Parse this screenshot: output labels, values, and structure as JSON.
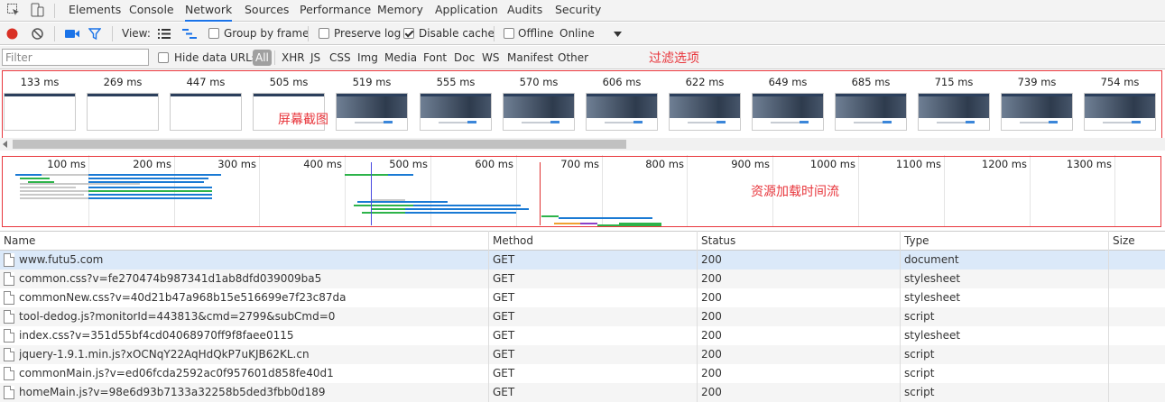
{
  "tabs": [
    "Elements",
    "Console",
    "Network",
    "Sources",
    "Performance",
    "Memory",
    "Application",
    "Audits",
    "Security"
  ],
  "toolbar": {
    "view_label": "View:",
    "group_by_frame": "Group by frame",
    "preserve_log": "Preserve log",
    "disable_cache": "Disable cache",
    "disable_cache_checked": true,
    "offline": "Offline",
    "throttle": "Online"
  },
  "filter": {
    "placeholder": "Filter",
    "hide_data_urls": "Hide data URLs",
    "types": [
      "All",
      "XHR",
      "JS",
      "CSS",
      "Img",
      "Media",
      "Font",
      "Doc",
      "WS",
      "Manifest",
      "Other"
    ]
  },
  "annotations": {
    "filter_options": "过滤选项",
    "screenshots": "屏幕截图",
    "waterfall": "资源加载时间流"
  },
  "screenshots": [
    {
      "time": "133 ms",
      "kind": "blank"
    },
    {
      "time": "269 ms",
      "kind": "blank"
    },
    {
      "time": "447 ms",
      "kind": "blank"
    },
    {
      "time": "505 ms",
      "kind": "blank"
    },
    {
      "time": "519 ms",
      "kind": "hero"
    },
    {
      "time": "555 ms",
      "kind": "hero"
    },
    {
      "time": "570 ms",
      "kind": "hero"
    },
    {
      "time": "606 ms",
      "kind": "hero"
    },
    {
      "time": "622 ms",
      "kind": "hero"
    },
    {
      "time": "649 ms",
      "kind": "hero"
    },
    {
      "time": "685 ms",
      "kind": "hero"
    },
    {
      "time": "715 ms",
      "kind": "hero"
    },
    {
      "time": "739 ms",
      "kind": "hero"
    },
    {
      "time": "754 ms",
      "kind": "hero"
    }
  ],
  "overview": {
    "ticks": [
      "100 ms",
      "200 ms",
      "300 ms",
      "400 ms",
      "500 ms",
      "600 ms",
      "700 ms",
      "800 ms",
      "900 ms",
      "1000 ms",
      "1100 ms",
      "1200 ms",
      "1300 ms"
    ],
    "colors": {
      "blue": "#1a7ad4",
      "green": "#2db34a",
      "gray": "#c9c9c9",
      "orange": "#f0a030",
      "purple": "#8b3fc7",
      "dom_line": "#4a4ae0",
      "load_line": "#e03030"
    }
  },
  "table": {
    "headers": [
      "Name",
      "Method",
      "Status",
      "Type",
      "Size"
    ],
    "rows": [
      {
        "name": "www.futu5.com",
        "method": "GET",
        "status": "200",
        "type": "document"
      },
      {
        "name": "common.css?v=fe270474b987341d1ab8dfd039009ba5",
        "method": "GET",
        "status": "200",
        "type": "stylesheet"
      },
      {
        "name": "commonNew.css?v=40d21b47a968b15e516699e7f23c87da",
        "method": "GET",
        "status": "200",
        "type": "stylesheet"
      },
      {
        "name": "tool-dedog.js?monitorId=443813&cmd=2799&subCmd=0",
        "method": "GET",
        "status": "200",
        "type": "script"
      },
      {
        "name": "index.css?v=351d55bf4cd04068970ff9f8faee0115",
        "method": "GET",
        "status": "200",
        "type": "stylesheet"
      },
      {
        "name": "jquery-1.9.1.min.js?xOCNqY22AqHdQkP7uKJB62KL.cn",
        "method": "GET",
        "status": "200",
        "type": "script"
      },
      {
        "name": "commonMain.js?v=ed06fcda2592ac0f957601d858fe40d1",
        "method": "GET",
        "status": "200",
        "type": "script"
      },
      {
        "name": "homeMain.js?v=98e6d93b7133a32258b5ded3fbb0d189",
        "method": "GET",
        "status": "200",
        "type": "script"
      }
    ]
  }
}
